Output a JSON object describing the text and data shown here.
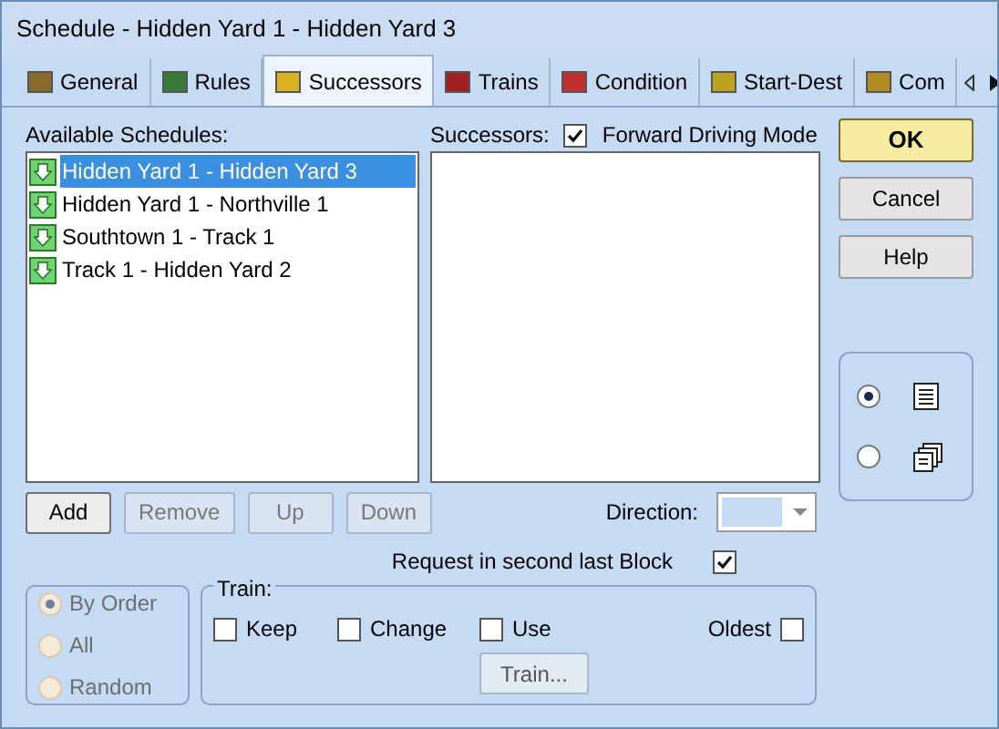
{
  "window": {
    "title": "Schedule - Hidden Yard 1 - Hidden Yard 3"
  },
  "tabs": [
    {
      "label": "General",
      "selected": false
    },
    {
      "label": "Rules",
      "selected": false
    },
    {
      "label": "Successors",
      "selected": true
    },
    {
      "label": "Trains",
      "selected": false
    },
    {
      "label": "Condition",
      "selected": false
    },
    {
      "label": "Start-Dest",
      "selected": false
    },
    {
      "label": "Com",
      "selected": false
    }
  ],
  "available": {
    "label": "Available Schedules:",
    "items": [
      {
        "text": "Hidden Yard 1 - Hidden Yard 3",
        "selected": true
      },
      {
        "text": "Hidden Yard 1 - Northville 1",
        "selected": false
      },
      {
        "text": "Southtown 1 - Track 1",
        "selected": false
      },
      {
        "text": "Track 1 - Hidden Yard 2",
        "selected": false
      }
    ]
  },
  "list_buttons": [
    {
      "label": "Add",
      "disabled": false
    },
    {
      "label": "Remove",
      "disabled": true
    },
    {
      "label": "Up",
      "disabled": true
    },
    {
      "label": "Down",
      "disabled": true
    }
  ],
  "successors": {
    "label": "Successors:",
    "forward": {
      "label": "Forward Driving Mode",
      "checked": true
    }
  },
  "direction": {
    "label": "Direction:"
  },
  "request": {
    "label": "Request in second last Block",
    "checked": true
  },
  "order": [
    {
      "label": "By Order",
      "selected": true,
      "disabled": true
    },
    {
      "label": "All",
      "selected": false,
      "disabled": true
    },
    {
      "label": "Random",
      "selected": false,
      "disabled": true
    }
  ],
  "train": {
    "title": "Train:",
    "options": [
      {
        "label": "Keep",
        "checked": false
      },
      {
        "label": "Change",
        "checked": false
      },
      {
        "label": "Use",
        "checked": false
      }
    ],
    "oldest": {
      "label": "Oldest",
      "checked": false
    },
    "button": "Train..."
  },
  "dialog_buttons": [
    {
      "label": "OK",
      "default": true
    },
    {
      "label": "Cancel",
      "default": false
    },
    {
      "label": "Help",
      "default": false
    }
  ],
  "view": [
    {
      "selected": true
    },
    {
      "selected": false
    }
  ]
}
